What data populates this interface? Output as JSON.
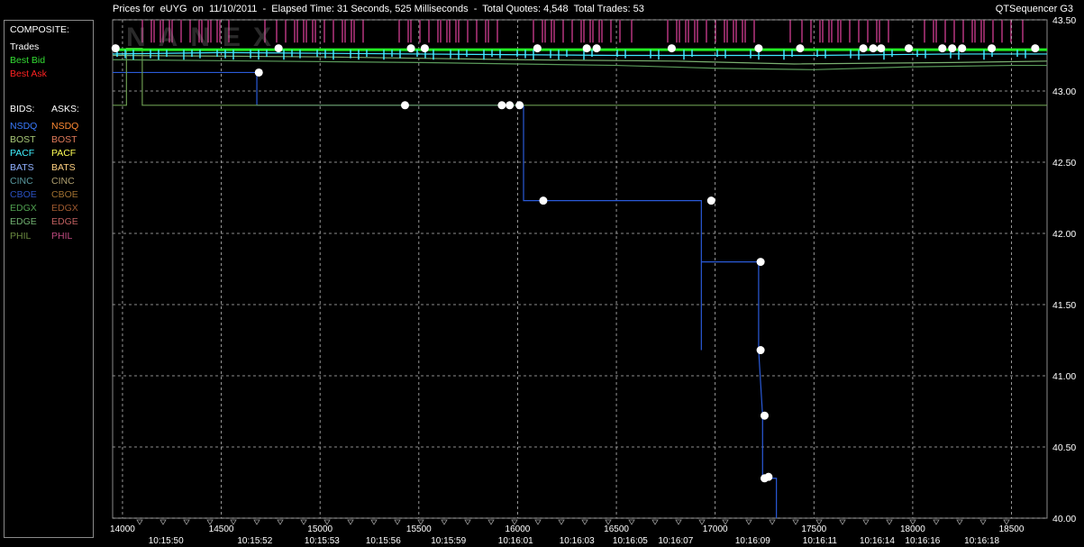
{
  "header": {
    "title": "Prices for  eUYG  on  11/10/2011  -  Elapsed Time: 31 Seconds, 525 Milliseconds  -  Total Quotes: 4,548  Total Trades: 53",
    "brand": "QTSequencer G3"
  },
  "watermark": "NANEX",
  "legend": {
    "composite_title": "COMPOSITE:",
    "composite": [
      {
        "label": "Trades",
        "color": "#ffffff"
      },
      {
        "label": "Best Bid",
        "color": "#33dd33"
      },
      {
        "label": "Best Ask",
        "color": "#ff2222"
      }
    ],
    "bids_title": "BIDS:",
    "asks_title": "ASKS:",
    "exchanges": [
      {
        "bid": "NSDQ",
        "ask": "NSDQ",
        "bid_color": "#3a7bff",
        "ask_color": "#ff8a33"
      },
      {
        "bid": "BOST",
        "ask": "BOST",
        "bid_color": "#a8c878",
        "ask_color": "#e07a5a"
      },
      {
        "bid": "PACF",
        "ask": "PACF",
        "bid_color": "#40f0ff",
        "ask_color": "#ffff55"
      },
      {
        "bid": "BATS",
        "ask": "BATS",
        "bid_color": "#8fb0ff",
        "ask_color": "#ffd080"
      },
      {
        "bid": "CINC",
        "ask": "CINC",
        "bid_color": "#5a9aa0",
        "ask_color": "#b0a070"
      },
      {
        "bid": "CBOE",
        "ask": "CBOE",
        "bid_color": "#2a50c0",
        "ask_color": "#a07030"
      },
      {
        "bid": "EDGX",
        "ask": "EDGX",
        "bid_color": "#50a050",
        "ask_color": "#a05a30"
      },
      {
        "bid": "EDGE",
        "ask": "EDGE",
        "bid_color": "#70b070",
        "ask_color": "#c06060"
      },
      {
        "bid": "PHIL",
        "ask": "PHIL",
        "bid_color": "#6a8a40",
        "ask_color": "#c04a80"
      }
    ]
  },
  "chart_data": {
    "type": "line",
    "xlim": [
      13950,
      18680
    ],
    "ylim": [
      40.0,
      43.5
    ],
    "grid": true,
    "y_ticks": [
      "43.50",
      "43.00",
      "42.50",
      "42.00",
      "41.50",
      "41.00",
      "40.50",
      "40.00"
    ],
    "x_ticks": [
      14000,
      14500,
      15000,
      15500,
      16000,
      16500,
      17000,
      17500,
      18000,
      18500
    ],
    "time_labels": [
      {
        "x": 14220,
        "label": "10:15:50"
      },
      {
        "x": 14670,
        "label": "10:15:52"
      },
      {
        "x": 15010,
        "label": "10:15:53"
      },
      {
        "x": 15320,
        "label": "10:15:56"
      },
      {
        "x": 15650,
        "label": "10:15:59"
      },
      {
        "x": 15990,
        "label": "10:16:01"
      },
      {
        "x": 16300,
        "label": "10:16:03"
      },
      {
        "x": 16570,
        "label": "10:16:05"
      },
      {
        "x": 16800,
        "label": "10:16:07"
      },
      {
        "x": 17190,
        "label": "10:16:09"
      },
      {
        "x": 17530,
        "label": "10:16:11"
      },
      {
        "x": 17820,
        "label": "10:16:14"
      },
      {
        "x": 18050,
        "label": "10:16:16"
      },
      {
        "x": 18350,
        "label": "10:16:18"
      }
    ],
    "series": [
      {
        "name": "NSDQ",
        "color": "#2a5ad8",
        "steps": [
          [
            13950,
            43.13
          ],
          [
            14680,
            43.13
          ],
          [
            14680,
            42.9
          ],
          [
            15920,
            42.9
          ],
          [
            15920,
            42.9
          ],
          [
            16030,
            42.9
          ],
          [
            16030,
            42.23
          ],
          [
            16930,
            42.23
          ],
          [
            16930,
            41.18
          ],
          [
            16930,
            41.8
          ],
          [
            17220,
            41.8
          ],
          [
            17220,
            41.18
          ],
          [
            17240,
            40.72
          ],
          [
            17240,
            40.28
          ],
          [
            17310,
            40.28
          ],
          [
            17310,
            40.0
          ]
        ]
      },
      {
        "name": "PHIL",
        "color": "#6a9a50",
        "steps": [
          [
            13950,
            42.9
          ],
          [
            14020,
            42.9
          ],
          [
            14020,
            43.3
          ],
          [
            14100,
            43.3
          ],
          [
            14100,
            42.9
          ],
          [
            18680,
            42.9
          ]
        ]
      },
      {
        "name": "EDGE",
        "color": "#5a9a5a",
        "steps": [
          [
            13950,
            43.22
          ],
          [
            15500,
            43.2
          ],
          [
            16500,
            43.18
          ],
          [
            17000,
            43.16
          ],
          [
            17500,
            43.15
          ],
          [
            18000,
            43.17
          ],
          [
            18500,
            43.18
          ],
          [
            18680,
            43.18
          ]
        ]
      },
      {
        "name": "BOST",
        "color": "#7ab070",
        "steps": [
          [
            13950,
            43.25
          ],
          [
            15000,
            43.24
          ],
          [
            16000,
            43.22
          ],
          [
            16800,
            43.21
          ],
          [
            17400,
            43.19
          ],
          [
            18200,
            43.2
          ],
          [
            18680,
            43.21
          ]
        ]
      },
      {
        "name": "PACF",
        "color": "#40e8ff",
        "steps": [
          [
            13950,
            43.26
          ],
          [
            14500,
            43.27
          ],
          [
            15500,
            43.26
          ],
          [
            16500,
            43.25
          ],
          [
            17500,
            43.25
          ],
          [
            18200,
            43.26
          ],
          [
            18680,
            43.26
          ]
        ]
      },
      {
        "name": "Best Bid",
        "color": "#22ee22",
        "steps": [
          [
            13950,
            43.29
          ],
          [
            18680,
            43.29
          ]
        ]
      }
    ],
    "trades": [
      {
        "x": 13965,
        "y": 43.3
      },
      {
        "x": 14690,
        "y": 43.13
      },
      {
        "x": 14790,
        "y": 43.3
      },
      {
        "x": 15430,
        "y": 42.9
      },
      {
        "x": 15460,
        "y": 43.3
      },
      {
        "x": 15530,
        "y": 43.3
      },
      {
        "x": 15920,
        "y": 42.9
      },
      {
        "x": 15960,
        "y": 42.9
      },
      {
        "x": 16010,
        "y": 42.9
      },
      {
        "x": 16100,
        "y": 43.3
      },
      {
        "x": 16130,
        "y": 42.23
      },
      {
        "x": 16350,
        "y": 43.3
      },
      {
        "x": 16400,
        "y": 43.3
      },
      {
        "x": 16780,
        "y": 43.3
      },
      {
        "x": 16980,
        "y": 42.23
      },
      {
        "x": 17220,
        "y": 43.3
      },
      {
        "x": 17230,
        "y": 41.8
      },
      {
        "x": 17230,
        "y": 41.18
      },
      {
        "x": 17250,
        "y": 40.72
      },
      {
        "x": 17250,
        "y": 40.28
      },
      {
        "x": 17270,
        "y": 40.29
      },
      {
        "x": 17430,
        "y": 43.3
      },
      {
        "x": 17750,
        "y": 43.3
      },
      {
        "x": 17800,
        "y": 43.3
      },
      {
        "x": 17840,
        "y": 43.3
      },
      {
        "x": 17980,
        "y": 43.3
      },
      {
        "x": 18150,
        "y": 43.3
      },
      {
        "x": 18200,
        "y": 43.3
      },
      {
        "x": 18250,
        "y": 43.3
      },
      {
        "x": 18400,
        "y": 43.3
      },
      {
        "x": 18620,
        "y": 43.3
      }
    ],
    "best_ask_band": {
      "y": 43.5,
      "y2": 43.34,
      "color": "#a03070"
    }
  }
}
